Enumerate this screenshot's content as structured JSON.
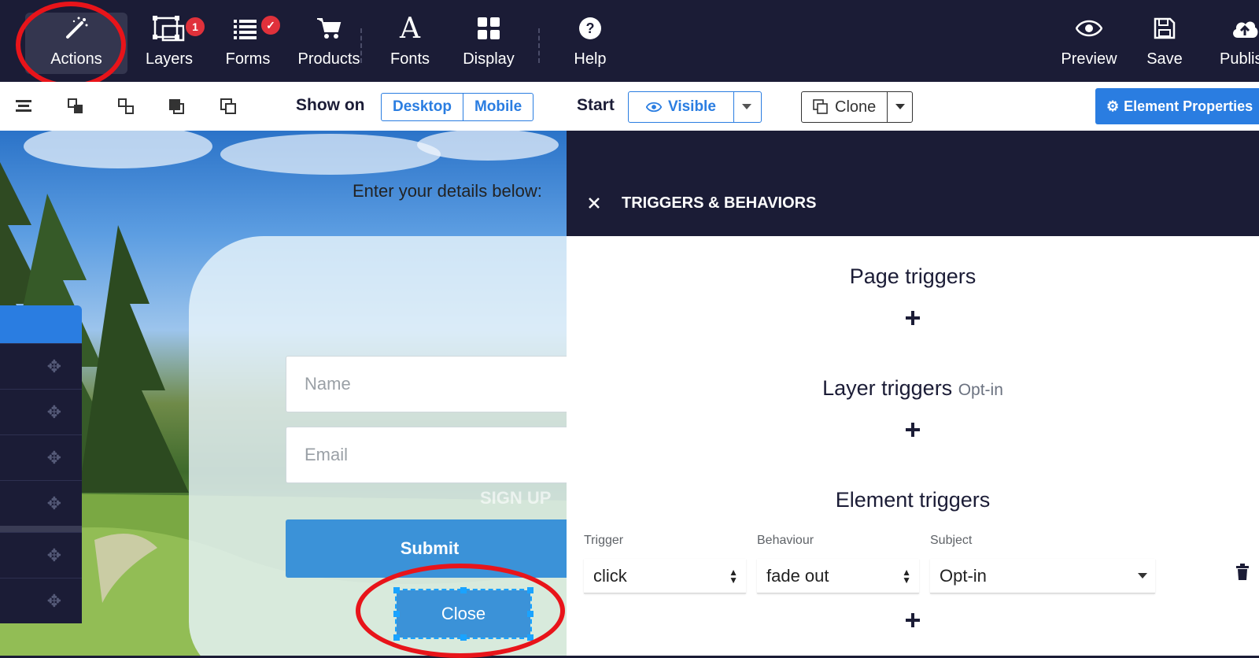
{
  "toolbar": {
    "items": [
      {
        "label": "Actions",
        "icon": "magic-wand-icon"
      },
      {
        "label": "Layers",
        "icon": "layers-icon",
        "badge": "1"
      },
      {
        "label": "Forms",
        "icon": "forms-list-icon"
      },
      {
        "label": "Products",
        "icon": "cart-icon"
      },
      {
        "label": "Fonts",
        "icon": "font-icon"
      },
      {
        "label": "Display",
        "icon": "grid-icon"
      },
      {
        "label": "Help",
        "icon": "help-icon"
      }
    ],
    "right": [
      {
        "label": "Preview",
        "icon": "eye-icon"
      },
      {
        "label": "Save",
        "icon": "save-icon"
      },
      {
        "label": "Publis",
        "icon": "cloud-upload-icon"
      }
    ]
  },
  "subbar": {
    "show_on_label": "Show on",
    "desktop": "Desktop",
    "mobile": "Mobile",
    "start_label": "Start",
    "visible": "Visible",
    "clone": "Clone",
    "element_properties": "Element Properties"
  },
  "canvas": {
    "heading": "Enter your details below:",
    "name_placeholder": "Name",
    "email_placeholder": "Email",
    "signup_ghost": "SIGN UP",
    "submit": "Submit",
    "close": "Close"
  },
  "panel": {
    "title": "TRIGGERS & BEHAVIORS",
    "page_triggers": "Page triggers",
    "layer_triggers": "Layer triggers",
    "layer_triggers_suffix": "Opt-in",
    "element_triggers": "Element triggers",
    "trigger_label": "Trigger",
    "behaviour_label": "Behaviour",
    "subject_label": "Subject",
    "trigger_value": "click",
    "behaviour_value": "fade out",
    "subject_value": "Opt-in"
  },
  "colors": {
    "navy": "#1b1c36",
    "accent_blue": "#2a7de1",
    "button_blue": "#3b92d8",
    "annotation_red": "#e8141a"
  }
}
